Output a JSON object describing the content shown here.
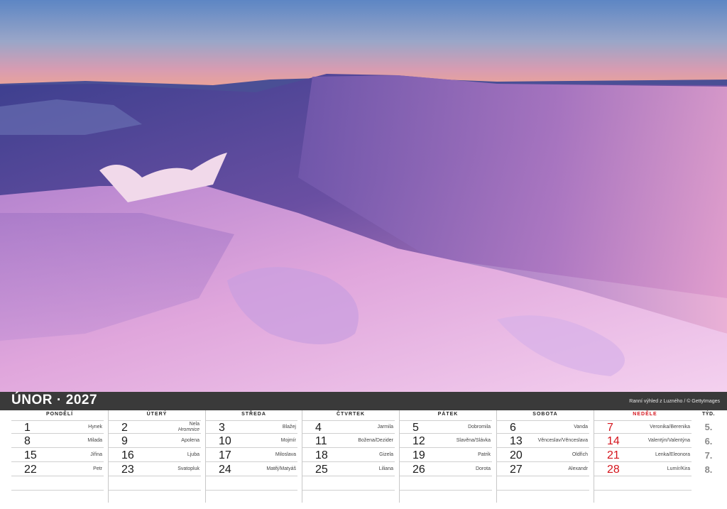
{
  "calendar": {
    "month": "ÚNOR",
    "separator": "·",
    "year": "2027",
    "photo_credit": "Ranní výhled z Luzného / © GettyImages",
    "weeks_header": "TÝD.",
    "weeks": [
      "5.",
      "6.",
      "7.",
      "8."
    ],
    "days": [
      {
        "name": "PONDĚLÍ",
        "red": false,
        "cells": [
          {
            "n": "1",
            "name": "Hynek"
          },
          {
            "n": "8",
            "name": "Milada"
          },
          {
            "n": "15",
            "name": "Jiřina"
          },
          {
            "n": "22",
            "name": "Petr"
          }
        ]
      },
      {
        "name": "ÚTERÝ",
        "red": false,
        "cells": [
          {
            "n": "2",
            "name": "Nela",
            "alt": "Hromnice"
          },
          {
            "n": "9",
            "name": "Apolena"
          },
          {
            "n": "16",
            "name": "Ljuba"
          },
          {
            "n": "23",
            "name": "Svatopluk"
          }
        ]
      },
      {
        "name": "STŘEDA",
        "red": false,
        "cells": [
          {
            "n": "3",
            "name": "Blažej"
          },
          {
            "n": "10",
            "name": "Mojmír"
          },
          {
            "n": "17",
            "name": "Miloslava"
          },
          {
            "n": "24",
            "name": "Matěj/Matyáš"
          }
        ]
      },
      {
        "name": "ČTVRTEK",
        "red": false,
        "cells": [
          {
            "n": "4",
            "name": "Jarmila"
          },
          {
            "n": "11",
            "name": "Božena/Dezider"
          },
          {
            "n": "18",
            "name": "Gizela"
          },
          {
            "n": "25",
            "name": "Liliana"
          }
        ]
      },
      {
        "name": "PÁTEK",
        "red": false,
        "cells": [
          {
            "n": "5",
            "name": "Dobromila"
          },
          {
            "n": "12",
            "name": "Slavěna/Slávka"
          },
          {
            "n": "19",
            "name": "Patrik"
          },
          {
            "n": "26",
            "name": "Dorota"
          }
        ]
      },
      {
        "name": "SOBOTA",
        "red": false,
        "cells": [
          {
            "n": "6",
            "name": "Vanda"
          },
          {
            "n": "13",
            "name": "Věnceslav/Věnceslava"
          },
          {
            "n": "20",
            "name": "Oldřich"
          },
          {
            "n": "27",
            "name": "Alexandr"
          }
        ]
      },
      {
        "name": "NEDĚLE",
        "red": true,
        "cells": [
          {
            "n": "7",
            "name": "Veronika/Berenika"
          },
          {
            "n": "14",
            "name": "Valentýn/Valentýna"
          },
          {
            "n": "21",
            "name": "Lenka/Eleonora"
          },
          {
            "n": "28",
            "name": "Lumír/Kira"
          }
        ]
      }
    ]
  },
  "colors": {
    "sunday_red": "#d4141c",
    "header_bar": "#3a3a3a"
  }
}
